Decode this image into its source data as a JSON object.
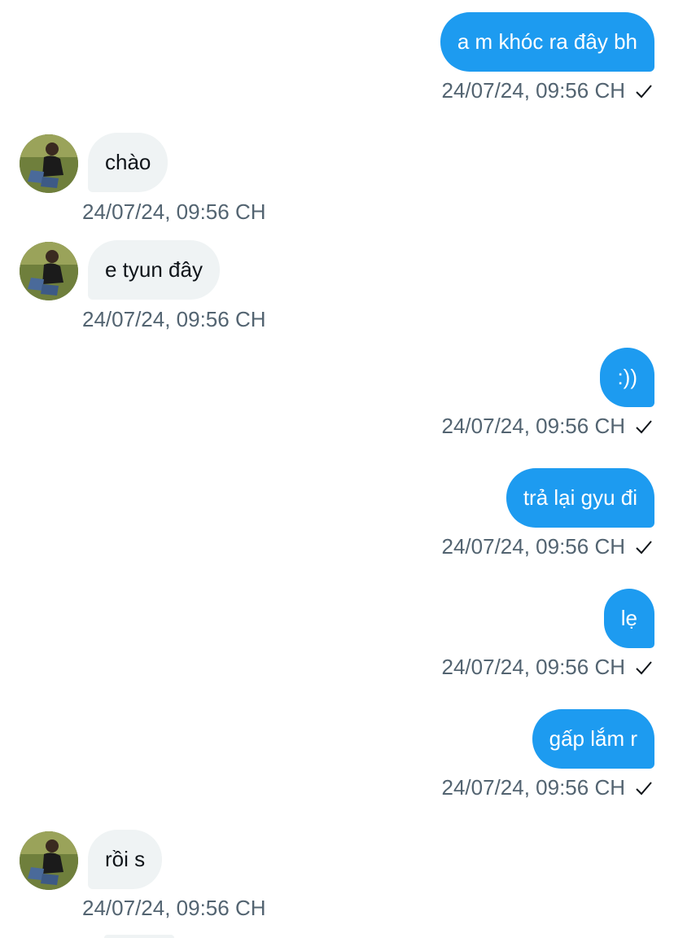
{
  "messages": [
    {
      "id": "m1",
      "direction": "sent",
      "text": "a m khóc ra đây bh",
      "time": "24/07/24, 09:56 CH",
      "status_icon": "check-icon"
    },
    {
      "id": "m2",
      "direction": "received",
      "text": "chào",
      "time": "24/07/24, 09:56 CH",
      "avatar_icon": "user-avatar"
    },
    {
      "id": "m3",
      "direction": "received",
      "text": "e tyun đây",
      "time": "24/07/24, 09:56 CH",
      "avatar_icon": "user-avatar"
    },
    {
      "id": "m4",
      "direction": "sent",
      "text": ":))",
      "time": "24/07/24, 09:56 CH",
      "status_icon": "check-icon"
    },
    {
      "id": "m5",
      "direction": "sent",
      "text": "trả lại gyu đi",
      "time": "24/07/24, 09:56 CH",
      "status_icon": "check-icon"
    },
    {
      "id": "m6",
      "direction": "sent",
      "text": "lẹ",
      "time": "24/07/24, 09:56 CH",
      "status_icon": "check-icon"
    },
    {
      "id": "m7",
      "direction": "sent",
      "text": "gấp lắm r",
      "time": "24/07/24, 09:56 CH",
      "status_icon": "check-icon"
    },
    {
      "id": "m8",
      "direction": "received",
      "text": "rồi s",
      "time": "24/07/24, 09:56 CH",
      "avatar_icon": "user-avatar"
    }
  ],
  "colors": {
    "sent_bubble": "#1d9bf0",
    "received_bubble": "#eff3f4",
    "timestamp": "#536471",
    "background": "#ffffff"
  }
}
